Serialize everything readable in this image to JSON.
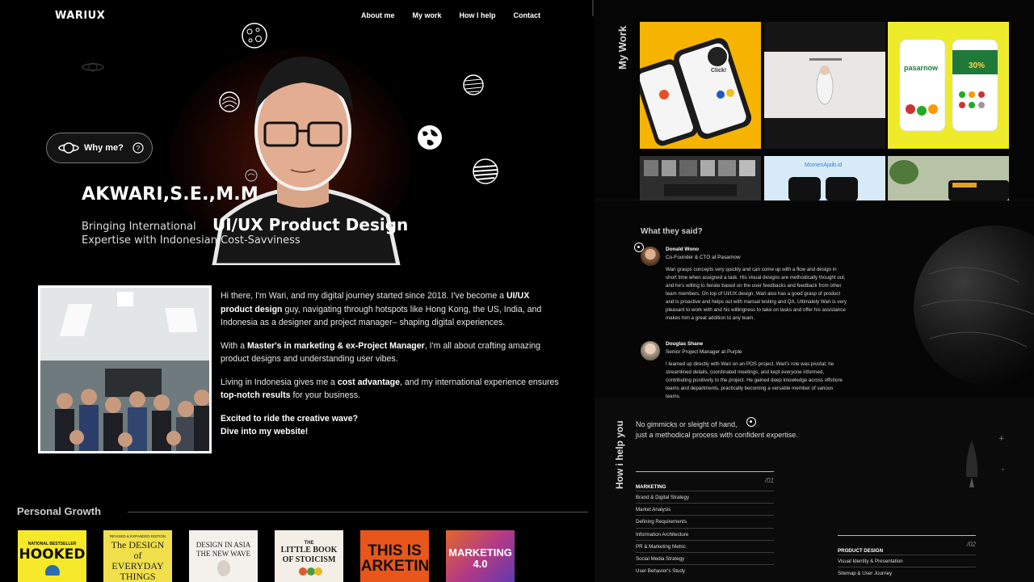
{
  "header": {
    "logo": "WARIUX",
    "nav": [
      "About me",
      "My work",
      "How I help",
      "Contact"
    ]
  },
  "hero": {
    "why_label": "Why me?",
    "name": "AKWARI,S.E.,M.M",
    "tagline_prefix": "Bringing International",
    "tagline_highlight": "UI/UX Product Design",
    "tagline_suffix": "Expertise with Indonesian Cost-Savviness"
  },
  "about": {
    "p1_a": "Hi there, I'm Wari, and my digital journey started since 2018. I've become a ",
    "p1_b": "UI/UX product design",
    "p1_c": " guy, navigating through hotspots like Hong Kong, the US, India, and Indonesia as a designer and project manager– shaping digital experiences.",
    "p2_a": "With a ",
    "p2_b": "Master's in marketing & ex-Project Manager",
    "p2_c": ", I'm all about crafting amazing product designs and understanding user vibes.",
    "p3_a": "Living in Indonesia gives me a ",
    "p3_b": "cost advantage",
    "p3_c": ", and my international experience ensures ",
    "p3_d": "top-notch results",
    "p3_e": " for your business.",
    "cta_1": "Excited to ride the creative wave?",
    "cta_2": "Dive into my website!"
  },
  "growth": {
    "title": "Personal Growth",
    "books": [
      {
        "top": "NATIONAL BESTSELLER",
        "title": "HOOKED",
        "bg": "#f5e92a",
        "fg": "#111"
      },
      {
        "top": "REVISED & EXPANDED EDITION",
        "title": "The DESIGN of EVERYDAY THINGS",
        "bg": "#f1df4b",
        "fg": "#222"
      },
      {
        "top": "",
        "title": "DESIGN IN ASIA THE NEW WAVE",
        "bg": "#f4f1ec",
        "fg": "#222"
      },
      {
        "top": "THE",
        "title": "LITTLE BOOK OF STOICISM",
        "bg": "#f3efe6",
        "fg": "#222"
      },
      {
        "top": "",
        "title": "THIS IS MARKETING",
        "bg": "#e8561b",
        "fg": "#111"
      },
      {
        "top": "",
        "title": "MARKETING 4.0",
        "bg": "#b33a86",
        "fg": "#fff"
      }
    ]
  },
  "work": {
    "label": "My Work",
    "tile_texts": {
      "click": "Click!",
      "pasar": "pasarnow",
      "momen": "MomenAjaib.id"
    }
  },
  "testimonials": {
    "title": "What they said?",
    "items": [
      {
        "name": "Donald Wono",
        "role": "Co-Founder & CTO at Pasarnow",
        "text": "Wari grasps concepts very quickly and can come up with a flow and design in short time when assigned a task. His visual designs are methodically thought out, and he's willing to iterate based on the user feedbacks and feedback from other team members. On top of UI/UX design, Wari also has a good grasp of product and is proactive and helps out with manual testing and QA. Ultimately Wari is very pleasant to work with and his willingness to take on tasks and offer his assistance makes him a great addition to any team."
      },
      {
        "name": "Douglas Shane",
        "role": "Senior Project Manager at Purple",
        "text": "I teamed up directly with Wari on an POS project. Wari's role was pivotal; he streamlined details, coordinated meetings, and kept everyone informed, contributing positively to the project. He gained deep knowledge across offshore teams and departments, practically becoming a versatile member of various teams."
      }
    ]
  },
  "help": {
    "label": "How i help you",
    "intro_1": "No gimmicks or sleight of hand,",
    "intro_2": "just a methodical process with confident expertise.",
    "services": [
      {
        "name": "MARKETING",
        "num": "/01",
        "items": [
          "Brand & Digital Strategy",
          "Market Analysis",
          "Defining Requirements",
          "Information Architecture",
          "PR & Marketing Metric",
          "Social Media Strategy",
          "User Behavior's Study"
        ]
      },
      {
        "name": "PRODUCT DESIGN",
        "num": "/02",
        "items": [
          "Visual Identity & Presentation",
          "Sitemap & User Journey"
        ]
      }
    ]
  }
}
